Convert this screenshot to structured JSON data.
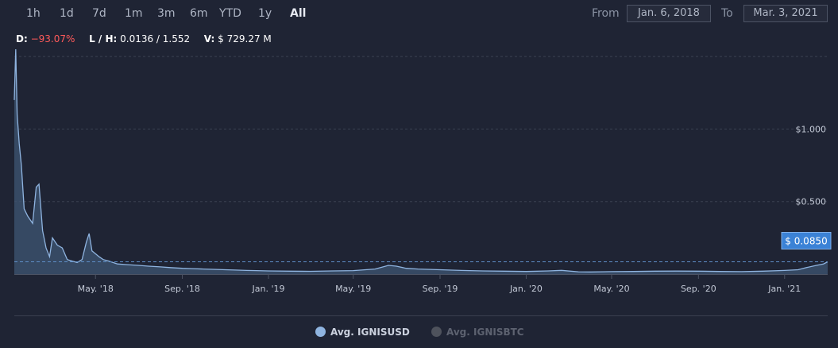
{
  "range_buttons": [
    {
      "label": "1h",
      "active": false
    },
    {
      "label": "1d",
      "active": false
    },
    {
      "label": "7d",
      "active": false
    },
    {
      "label": "1m",
      "active": false
    },
    {
      "label": "3m",
      "active": false
    },
    {
      "label": "6m",
      "active": false
    },
    {
      "label": "YTD",
      "active": false
    },
    {
      "label": "1y",
      "active": false
    },
    {
      "label": "All",
      "active": true
    }
  ],
  "date_range": {
    "from_label": "From",
    "from_value": "Jan. 6, 2018",
    "to_label": "To",
    "to_value": "Mar. 3, 2021"
  },
  "stats": {
    "d_label": "D:",
    "d_value": "−93.07%",
    "lh_label": "L / H:",
    "lh_value": "0.0136 / 1.552",
    "v_label": "V:",
    "v_value": "$ 729.27 M"
  },
  "colors": {
    "background": "#1f2434",
    "series_line": "#8fb4e0",
    "series_fill": "#3f5673",
    "current_price_badge": "#3b82d6",
    "negative": "#ff5a5a",
    "legend_inactive": "#5d6270"
  },
  "legend": [
    {
      "name": "Avg. IGNISUSD",
      "active": true
    },
    {
      "name": "Avg. IGNISBTC",
      "active": false
    }
  ],
  "chart_data": {
    "type": "area",
    "series": [
      {
        "name": "Avg. IGNISUSD",
        "x": [
          "2018-01-06",
          "2018-01-08",
          "2018-01-10",
          "2018-01-13",
          "2018-01-16",
          "2018-01-20",
          "2018-01-25",
          "2018-02-01",
          "2018-02-06",
          "2018-02-10",
          "2018-02-15",
          "2018-02-20",
          "2018-02-25",
          "2018-03-01",
          "2018-03-08",
          "2018-03-15",
          "2018-03-22",
          "2018-03-29",
          "2018-04-05",
          "2018-04-12",
          "2018-04-18",
          "2018-04-22",
          "2018-04-26",
          "2018-05-01",
          "2018-05-06",
          "2018-05-12",
          "2018-05-20",
          "2018-06-01",
          "2018-06-15",
          "2018-07-01",
          "2018-07-15",
          "2018-08-01",
          "2018-08-15",
          "2018-09-01",
          "2018-09-15",
          "2018-10-01",
          "2018-10-15",
          "2018-11-01",
          "2018-11-15",
          "2018-12-01",
          "2018-12-15",
          "2019-01-01",
          "2019-02-01",
          "2019-03-01",
          "2019-04-01",
          "2019-05-01",
          "2019-06-01",
          "2019-06-20",
          "2019-07-01",
          "2019-07-15",
          "2019-08-01",
          "2019-09-01",
          "2019-10-01",
          "2019-11-01",
          "2019-12-01",
          "2020-01-01",
          "2020-02-01",
          "2020-02-20",
          "2020-03-15",
          "2020-04-01",
          "2020-05-01",
          "2020-06-01",
          "2020-07-01",
          "2020-08-01",
          "2020-09-01",
          "2020-10-01",
          "2020-11-01",
          "2020-12-01",
          "2021-01-01",
          "2021-01-20",
          "2021-02-01",
          "2021-02-15",
          "2021-02-25",
          "2021-03-03"
        ],
        "y": [
          1.2,
          1.55,
          1.1,
          0.9,
          0.75,
          0.45,
          0.4,
          0.35,
          0.6,
          0.62,
          0.3,
          0.18,
          0.12,
          0.25,
          0.2,
          0.18,
          0.1,
          0.09,
          0.08,
          0.1,
          0.22,
          0.28,
          0.16,
          0.14,
          0.12,
          0.1,
          0.09,
          0.07,
          0.065,
          0.06,
          0.055,
          0.05,
          0.045,
          0.04,
          0.038,
          0.035,
          0.033,
          0.03,
          0.028,
          0.025,
          0.024,
          0.022,
          0.02,
          0.019,
          0.022,
          0.024,
          0.035,
          0.06,
          0.055,
          0.04,
          0.035,
          0.03,
          0.025,
          0.022,
          0.02,
          0.018,
          0.022,
          0.026,
          0.016,
          0.015,
          0.017,
          0.018,
          0.02,
          0.021,
          0.02,
          0.018,
          0.017,
          0.02,
          0.025,
          0.03,
          0.045,
          0.06,
          0.07,
          0.085
        ]
      }
    ],
    "x_ticks": [
      "May. '18",
      "Sep. '18",
      "Jan. '19",
      "May. '19",
      "Sep. '19",
      "Jan. '20",
      "May. '20",
      "Sep. '20",
      "Jan. '21"
    ],
    "x_tick_dates": [
      "2018-05-01",
      "2018-09-01",
      "2019-01-01",
      "2019-05-01",
      "2019-09-01",
      "2020-01-01",
      "2020-05-01",
      "2020-09-01",
      "2021-01-01"
    ],
    "x_range": [
      "2018-01-06",
      "2021-03-03"
    ],
    "y_ticks": [
      {
        "value": 0.5,
        "label": "$0.500"
      },
      {
        "value": 1.0,
        "label": "$1.000"
      }
    ],
    "ylim": [
      0,
      1.55
    ],
    "current_price": {
      "value": 0.085,
      "label": "$ 0.0850"
    },
    "grid": "horizontal-dashed",
    "legend_position": "bottom-center"
  }
}
